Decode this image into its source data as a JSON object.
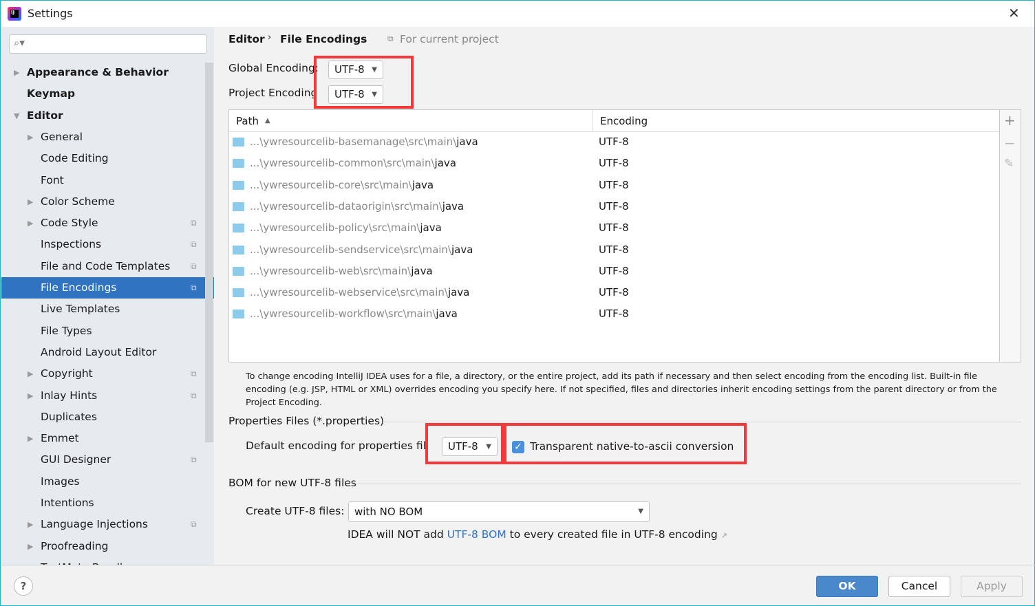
{
  "window": {
    "title": "Settings",
    "close_icon": "close-icon"
  },
  "sidebar": {
    "search_placeholder": "",
    "items": [
      {
        "label": "Appearance & Behavior",
        "level": 0,
        "expandable": true,
        "bold": true
      },
      {
        "label": "Keymap",
        "level": 0,
        "bold": true
      },
      {
        "label": "Editor",
        "level": 0,
        "expanded": true,
        "bold": true
      },
      {
        "label": "General",
        "level": 1,
        "expandable": true
      },
      {
        "label": "Code Editing",
        "level": 1
      },
      {
        "label": "Font",
        "level": 1
      },
      {
        "label": "Color Scheme",
        "level": 1,
        "expandable": true
      },
      {
        "label": "Code Style",
        "level": 1,
        "expandable": true,
        "project": true
      },
      {
        "label": "Inspections",
        "level": 1,
        "project": true
      },
      {
        "label": "File and Code Templates",
        "level": 1,
        "project": true
      },
      {
        "label": "File Encodings",
        "level": 1,
        "project": true,
        "selected": true
      },
      {
        "label": "Live Templates",
        "level": 1
      },
      {
        "label": "File Types",
        "level": 1
      },
      {
        "label": "Android Layout Editor",
        "level": 1
      },
      {
        "label": "Copyright",
        "level": 1,
        "expandable": true,
        "project": true
      },
      {
        "label": "Inlay Hints",
        "level": 1,
        "expandable": true,
        "project": true
      },
      {
        "label": "Duplicates",
        "level": 1
      },
      {
        "label": "Emmet",
        "level": 1,
        "expandable": true
      },
      {
        "label": "GUI Designer",
        "level": 1,
        "project": true
      },
      {
        "label": "Images",
        "level": 1
      },
      {
        "label": "Intentions",
        "level": 1
      },
      {
        "label": "Language Injections",
        "level": 1,
        "expandable": true,
        "project": true
      },
      {
        "label": "Proofreading",
        "level": 1,
        "expandable": true
      },
      {
        "label": "TextMate Bundles",
        "level": 1
      }
    ]
  },
  "breadcrumb": {
    "parent": "Editor",
    "current": "File Encodings",
    "scope": "For current project"
  },
  "global_encoding": {
    "label": "Global Encoding:",
    "value": "UTF-8"
  },
  "project_encoding": {
    "label": "Project Encoding",
    "value": "UTF-8"
  },
  "table": {
    "columns": [
      "Path",
      "Encoding"
    ],
    "sort": "ascending",
    "rows": [
      {
        "prefix": "...\\ywresourcelib-basemanage\\src\\main\\",
        "name": "java",
        "encoding": "UTF-8"
      },
      {
        "prefix": "...\\ywresourcelib-common\\src\\main\\",
        "name": "java",
        "encoding": "UTF-8"
      },
      {
        "prefix": "...\\ywresourcelib-core\\src\\main\\",
        "name": "java",
        "encoding": "UTF-8"
      },
      {
        "prefix": "...\\ywresourcelib-dataorigin\\src\\main\\",
        "name": "java",
        "encoding": "UTF-8"
      },
      {
        "prefix": "...\\ywresourcelib-policy\\src\\main\\",
        "name": "java",
        "encoding": "UTF-8"
      },
      {
        "prefix": "...\\ywresourcelib-sendservice\\src\\main\\",
        "name": "java",
        "encoding": "UTF-8"
      },
      {
        "prefix": "...\\ywresourcelib-web\\src\\main\\",
        "name": "java",
        "encoding": "UTF-8"
      },
      {
        "prefix": "...\\ywresourcelib-webservice\\src\\main\\",
        "name": "java",
        "encoding": "UTF-8"
      },
      {
        "prefix": "...\\ywresourcelib-workflow\\src\\main\\",
        "name": "java",
        "encoding": "UTF-8"
      }
    ],
    "tools": {
      "add": "+",
      "remove": "−",
      "edit": "✎"
    }
  },
  "hint": "To change encoding IntelliJ IDEA uses for a file, a directory, or the entire project, add its path if necessary and then select encoding from the encoding list. Built-in file encoding (e.g. JSP, HTML or XML) overrides encoding you specify here. If not specified, files and directories inherit encoding settings from the parent directory or from the Project Encoding.",
  "properties": {
    "section": "Properties Files (*.properties)",
    "label": "Default encoding for properties files",
    "value": "UTF-8",
    "checkbox_label": "Transparent native-to-ascii conversion",
    "checked": true
  },
  "bom": {
    "section": "BOM for new UTF-8 files",
    "label": "Create UTF-8 files:",
    "value": "with NO BOM",
    "note_pre": "IDEA will NOT add ",
    "note_link": "UTF-8 BOM",
    "note_post": " to every created file in UTF-8 encoding"
  },
  "buttons": {
    "ok": "OK",
    "cancel": "Cancel",
    "apply": "Apply",
    "help": "?"
  },
  "colors": {
    "accent": "#2f73c1",
    "highlight": "#f33a3a"
  }
}
